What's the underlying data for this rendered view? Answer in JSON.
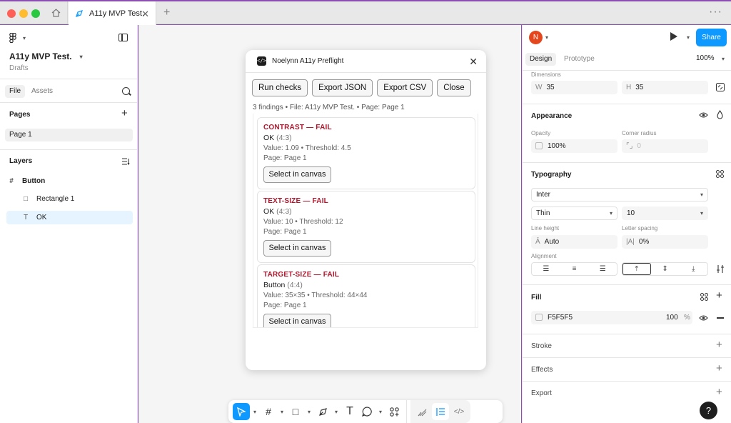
{
  "window": {
    "tab_title": "A11y MVP Test.",
    "close_glyph": "✕",
    "new_tab_glyph": "+",
    "more_glyph": "···"
  },
  "sidebar": {
    "doc_title": "A11y MVP Test.",
    "doc_location": "Drafts",
    "tab_file": "File",
    "tab_assets": "Assets",
    "pages_label": "Pages",
    "page_1": "Page 1",
    "layers_label": "Layers",
    "layers": [
      {
        "name": "Button",
        "icon": "#"
      },
      {
        "name": "Rectangle 1",
        "icon": "□"
      },
      {
        "name": "OK",
        "icon": "T"
      }
    ]
  },
  "plugin": {
    "title": "Noelynn A11y Preflight",
    "buttons": [
      "Run checks",
      "Export JSON",
      "Export CSV",
      "Close"
    ],
    "summary": "3 findings • File: A11y MVP Test. • Page: Page 1",
    "select_label": "Select in canvas",
    "findings": [
      {
        "title": "CONTRAST — FAIL",
        "name": "OK",
        "ref": "(4:3)",
        "meta": "Value: 1.09 • Threshold: 4.5",
        "page": "Page: Page 1"
      },
      {
        "title": "TEXT-SIZE — FAIL",
        "name": "OK",
        "ref": "(4:3)",
        "meta": "Value: 10 • Threshold: 12",
        "page": "Page: Page 1"
      },
      {
        "title": "TARGET-SIZE — FAIL",
        "name": "Button",
        "ref": "(4:4)",
        "meta": "Value: 35×35 • Threshold: 44×44",
        "page": "Page: Page 1"
      }
    ]
  },
  "right": {
    "avatar_initial": "N",
    "share_label": "Share",
    "tab_design": "Design",
    "tab_prototype": "Prototype",
    "zoom": "100%",
    "dimensions_label": "Dimensions",
    "width_prefix": "W",
    "width_value": "35",
    "height_prefix": "H",
    "height_value": "35",
    "appearance_label": "Appearance",
    "opacity_label": "Opacity",
    "opacity_value": "100%",
    "corner_label": "Corner radius",
    "corner_value": "0",
    "typography_label": "Typography",
    "font_family": "Inter",
    "font_weight": "Thin",
    "font_size": "10",
    "line_height_label": "Line height",
    "line_height_value": "Auto",
    "letter_spacing_label": "Letter spacing",
    "letter_spacing_value": "0%",
    "alignment_label": "Alignment",
    "fill_label": "Fill",
    "fill_hex": "F5F5F5",
    "fill_opacity": "100",
    "fill_percent": "%",
    "stroke_label": "Stroke",
    "effects_label": "Effects",
    "export_label": "Export",
    "help_glyph": "?"
  },
  "colors": {
    "accent": "#0d99ff",
    "fail_red": "#b0172c",
    "avatar": "#e4471e"
  }
}
